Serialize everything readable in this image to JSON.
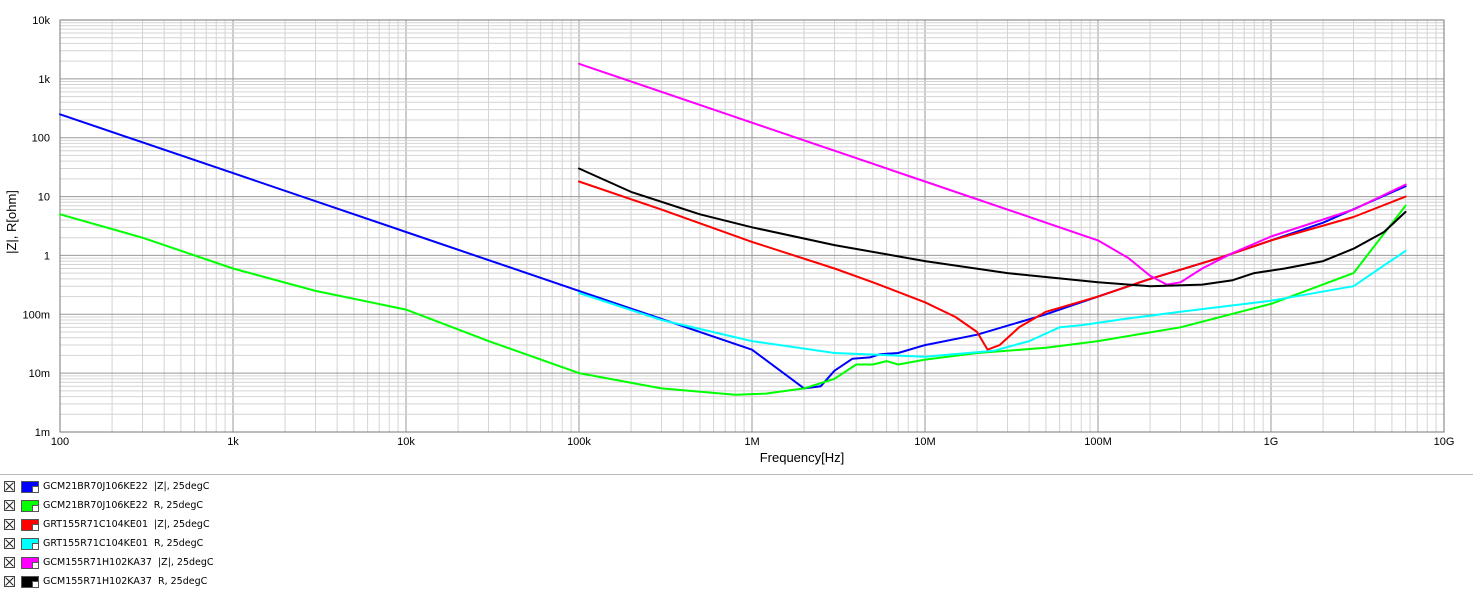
{
  "chart_data": {
    "type": "line",
    "xscale": "log",
    "yscale": "log",
    "xlim": [
      100,
      10000000000
    ],
    "ylim": [
      0.001,
      10000
    ],
    "grid": true,
    "xlabel": "Frequency[Hz]",
    "ylabel": "|Z|, R[ohm]",
    "x_tick_labels": [
      "100",
      "1k",
      "10k",
      "100k",
      "1M",
      "10M",
      "100M",
      "1G",
      "10G"
    ],
    "y_tick_labels": [
      "1m",
      "10m",
      "100m",
      "1",
      "10",
      "100",
      "1k",
      "10k"
    ],
    "series": [
      {
        "name": "GCM21BR70J106KE22  |Z|, 25degC",
        "color": "#0000ff",
        "points": [
          [
            100,
            250
          ],
          [
            1000,
            25
          ],
          [
            10000,
            2.5
          ],
          [
            100000,
            0.25
          ],
          [
            1000000,
            0.025
          ],
          [
            2000000,
            0.0055
          ],
          [
            2500000,
            0.006
          ],
          [
            3000000,
            0.011
          ],
          [
            3800000,
            0.0175
          ],
          [
            4800000,
            0.0185
          ],
          [
            5500000,
            0.021
          ],
          [
            7000000,
            0.022
          ],
          [
            10000000,
            0.03
          ],
          [
            20000000,
            0.045
          ],
          [
            50000000,
            0.1
          ],
          [
            100000000,
            0.2
          ],
          [
            200000000,
            0.4
          ],
          [
            500000000,
            0.9
          ],
          [
            1000000000,
            1.8
          ],
          [
            2000000000,
            3.6
          ],
          [
            6000000000,
            15
          ]
        ]
      },
      {
        "name": "GCM21BR70J106KE22  R, 25degC",
        "color": "#00ff00",
        "points": [
          [
            100,
            5
          ],
          [
            300,
            2
          ],
          [
            1000,
            0.6
          ],
          [
            3000,
            0.25
          ],
          [
            10000,
            0.12
          ],
          [
            30000,
            0.035
          ],
          [
            100000,
            0.01
          ],
          [
            300000,
            0.0055
          ],
          [
            800000,
            0.0043
          ],
          [
            1200000,
            0.0045
          ],
          [
            2000000,
            0.0055
          ],
          [
            3000000,
            0.008
          ],
          [
            4000000,
            0.014
          ],
          [
            5000000,
            0.014
          ],
          [
            6000000,
            0.016
          ],
          [
            7000000,
            0.014
          ],
          [
            10000000,
            0.017
          ],
          [
            20000000,
            0.022
          ],
          [
            50000000,
            0.027
          ],
          [
            100000000,
            0.035
          ],
          [
            300000000,
            0.06
          ],
          [
            1000000000,
            0.15
          ],
          [
            3000000000,
            0.5
          ],
          [
            6000000000,
            7
          ]
        ]
      },
      {
        "name": "GRT155R71C104KE01  |Z|, 25degC",
        "color": "#ff0000",
        "points": [
          [
            100000,
            18
          ],
          [
            300000,
            6
          ],
          [
            1000000,
            1.7
          ],
          [
            3000000,
            0.6
          ],
          [
            5000000,
            0.35
          ],
          [
            10000000,
            0.16
          ],
          [
            15000000,
            0.09
          ],
          [
            20000000,
            0.05
          ],
          [
            23000000,
            0.025
          ],
          [
            27000000,
            0.03
          ],
          [
            35000000,
            0.06
          ],
          [
            50000000,
            0.11
          ],
          [
            100000000,
            0.2
          ],
          [
            200000000,
            0.4
          ],
          [
            500000000,
            0.9
          ],
          [
            1000000000,
            1.8
          ],
          [
            3000000000,
            4.5
          ],
          [
            6000000000,
            10
          ]
        ]
      },
      {
        "name": "GRT155R71C104KE01  R, 25degC",
        "color": "#00ffff",
        "points": [
          [
            100000,
            0.23
          ],
          [
            300000,
            0.08
          ],
          [
            1000000,
            0.035
          ],
          [
            3000000,
            0.022
          ],
          [
            10000000,
            0.019
          ],
          [
            25000000,
            0.024
          ],
          [
            40000000,
            0.035
          ],
          [
            60000000,
            0.06
          ],
          [
            80000000,
            0.065
          ],
          [
            150000000,
            0.085
          ],
          [
            300000000,
            0.11
          ],
          [
            1000000000,
            0.17
          ],
          [
            3000000000,
            0.3
          ],
          [
            6000000000,
            1.2
          ]
        ]
      },
      {
        "name": "GCM155R71H102KA37  |Z|, 25degC",
        "color": "#ff00ff",
        "points": [
          [
            100000,
            1800
          ],
          [
            1000000,
            180
          ],
          [
            10000000,
            18
          ],
          [
            100000000,
            1.8
          ],
          [
            150000000,
            0.9
          ],
          [
            200000000,
            0.45
          ],
          [
            250000000,
            0.32
          ],
          [
            300000000,
            0.35
          ],
          [
            400000000,
            0.6
          ],
          [
            600000000,
            1.1
          ],
          [
            1000000000,
            2.1
          ],
          [
            3000000000,
            6
          ],
          [
            6000000000,
            16
          ]
        ]
      },
      {
        "name": "GCM155R71H102KA37  R, 25degC",
        "color": "#000000",
        "points": [
          [
            100000,
            30
          ],
          [
            200000,
            12
          ],
          [
            500000,
            5
          ],
          [
            1000000,
            3
          ],
          [
            3000000,
            1.5
          ],
          [
            10000000,
            0.8
          ],
          [
            30000000,
            0.5
          ],
          [
            100000000,
            0.35
          ],
          [
            200000000,
            0.3
          ],
          [
            400000000,
            0.32
          ],
          [
            600000000,
            0.38
          ],
          [
            800000000,
            0.5
          ],
          [
            1200000000,
            0.6
          ],
          [
            2000000000,
            0.8
          ],
          [
            3000000000,
            1.3
          ],
          [
            4500000000,
            2.5
          ],
          [
            6000000000,
            5.5
          ]
        ]
      }
    ]
  },
  "legend": {
    "items": [
      {
        "label": "GCM21BR70J106KE22  |Z|, 25degC",
        "color": "#0000ff"
      },
      {
        "label": "GCM21BR70J106KE22  R, 25degC",
        "color": "#00ff00"
      },
      {
        "label": "GRT155R71C104KE01  |Z|, 25degC",
        "color": "#ff0000"
      },
      {
        "label": "GRT155R71C104KE01  R, 25degC",
        "color": "#00ffff"
      },
      {
        "label": "GCM155R71H102KA37  |Z|, 25degC",
        "color": "#ff00ff"
      },
      {
        "label": "GCM155R71H102KA37  R, 25degC",
        "color": "#000000"
      }
    ]
  }
}
